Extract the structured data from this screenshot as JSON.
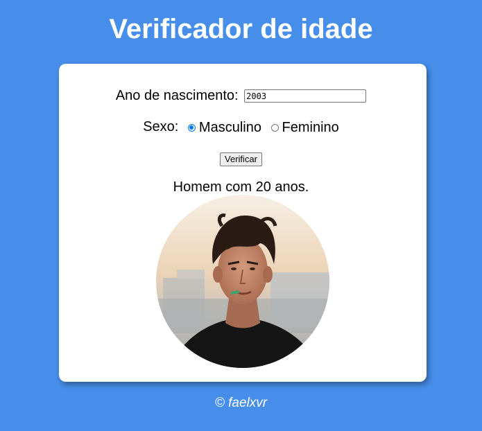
{
  "header": {
    "title": "Verificador de idade"
  },
  "form": {
    "year_label": "Ano de nascimento:",
    "year_value": "2003",
    "sex_label": "Sexo:",
    "sex_options": [
      {
        "label": "Masculino",
        "checked": true
      },
      {
        "label": "Feminino",
        "checked": false
      }
    ],
    "verify_label": "Verificar"
  },
  "result": {
    "text": "Homem com 20 anos.",
    "image_icon": "portrait-photo"
  },
  "footer": {
    "credit": "© faelxvr"
  },
  "colors": {
    "background": "#468ee9",
    "card": "#ffffff",
    "radio_accent": "#0075ff"
  }
}
